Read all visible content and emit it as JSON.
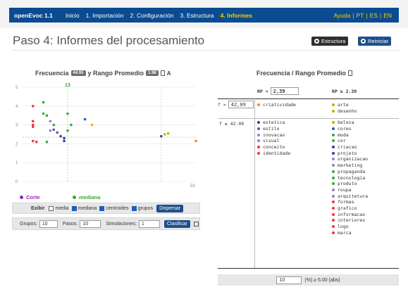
{
  "nav": {
    "brand": "openEvoc 1.1",
    "items": [
      "Inicio",
      "1. Importación",
      "2. Configuración",
      "3. Estructura",
      "4. Informes"
    ],
    "help": "Ayuda",
    "langs": [
      "PT",
      "ES",
      "EN"
    ]
  },
  "page": {
    "title": "Paso 4: Informes del procesamiento",
    "estructura_button": "Estructura",
    "reiniciar_button": "Reiniciar"
  },
  "left": {
    "title_a": "Frecuencia",
    "badge_a": "44.95",
    "title_b": "y Rango Promedio",
    "badge_b": "1.98",
    "legend_corte": "Corte",
    "legend_mediana": "mediana",
    "colors": {
      "corte": "#a020c0",
      "mediana": "#3aa83a",
      "accent": "#f08a1c"
    },
    "exhibir": {
      "label": "Exibir",
      "options": [
        "media",
        "mediana",
        "centroides",
        "grupos"
      ],
      "checked": [
        false,
        true,
        true,
        true
      ],
      "button": "Dispersar"
    },
    "params": {
      "grupos_label": "Grupos:",
      "grupos": "10",
      "pasos_label": "Pasos:",
      "pasos": "10",
      "sim_label": "Simulaciones:",
      "sim": "1",
      "button": "Clasificar"
    }
  },
  "chart_data": {
    "type": "scatter",
    "xlim": [
      0,
      50
    ],
    "ylim": [
      0,
      5
    ],
    "yticks": [
      "0",
      "1",
      "2",
      "3",
      "4",
      "5"
    ],
    "xticks": [
      "0",
      "50"
    ],
    "mark_x": "13",
    "ref_x": 13,
    "ref_y": 2.35,
    "ref_x2": 40,
    "points": [
      {
        "x": 3,
        "y": 4.0,
        "c": "#e8374a"
      },
      {
        "x": 3,
        "y": 3.2,
        "c": "#e8374a"
      },
      {
        "x": 3,
        "y": 3.0,
        "c": "#e8374a"
      },
      {
        "x": 3,
        "y": 2.9,
        "c": "#e8374a"
      },
      {
        "x": 3,
        "y": 2.15,
        "c": "#e8374a"
      },
      {
        "x": 4,
        "y": 2.1,
        "c": "#e8374a"
      },
      {
        "x": 6,
        "y": 4.2,
        "c": "#3aa83a"
      },
      {
        "x": 6,
        "y": 3.6,
        "c": "#3aa83a"
      },
      {
        "x": 7,
        "y": 3.5,
        "c": "#3aa83a"
      },
      {
        "x": 7,
        "y": 2.1,
        "c": "#3aa83a"
      },
      {
        "x": 8,
        "y": 3.2,
        "c": "#9c7bcf"
      },
      {
        "x": 9,
        "y": 3.0,
        "c": "#3aa83a"
      },
      {
        "x": 8,
        "y": 2.7,
        "c": "#9c7bcf"
      },
      {
        "x": 9,
        "y": 2.75,
        "c": "#6a4fb2"
      },
      {
        "x": 10,
        "y": 2.6,
        "c": "#6a4fb2"
      },
      {
        "x": 11,
        "y": 2.4,
        "c": "#3a3a9c"
      },
      {
        "x": 12,
        "y": 2.3,
        "c": "#3a3a9c"
      },
      {
        "x": 12,
        "y": 2.15,
        "c": "#3a3a9c"
      },
      {
        "x": 13,
        "y": 3.6,
        "c": "#3aa83a"
      },
      {
        "x": 14,
        "y": 3.0,
        "c": "#3aa83a"
      },
      {
        "x": 13,
        "y": 2.7,
        "c": "#3aa83a"
      },
      {
        "x": 20,
        "y": 3.0,
        "c": "#f5b400"
      },
      {
        "x": 18,
        "y": 3.3,
        "c": "#1d5fb8"
      },
      {
        "x": 40,
        "y": 2.4,
        "c": "#3a3a9c"
      },
      {
        "x": 41,
        "y": 2.5,
        "c": "#b8b800"
      },
      {
        "x": 42,
        "y": 2.55,
        "c": "#b8b800"
      },
      {
        "x": 50,
        "y": 2.15,
        "c": "#f08a1c"
      }
    ]
  },
  "right": {
    "title": "Frecuencia / Rango Promedio",
    "col1_label": "RP <",
    "col1_value": "2,39",
    "col2_label": "RP ≥ 2.39",
    "row1_label": "f >",
    "row1_value": "42,09",
    "row2_label": "f ≤ 42.09",
    "q1": [
      {
        "t": "criatividade",
        "c": "#f08a1c"
      }
    ],
    "q2": [
      {
        "t": "arte",
        "c": "#c0b000"
      },
      {
        "t": "desenho",
        "c": "#c0b000"
      }
    ],
    "q3": [
      {
        "t": "estetica",
        "c": "#3a3a9c"
      },
      {
        "t": "estilo",
        "c": "#6a4fb2"
      },
      {
        "t": "inovacao",
        "c": "#9c7bcf"
      },
      {
        "t": "visual",
        "c": "#9c7bcf"
      },
      {
        "t": "conceito",
        "c": "#e8374a"
      },
      {
        "t": "identidade",
        "c": "#e8374a"
      }
    ],
    "q4": [
      {
        "t": "beleza",
        "c": "#c0b000"
      },
      {
        "t": "cores",
        "c": "#1d5fb8"
      },
      {
        "t": "moda",
        "c": "#3aa83a"
      },
      {
        "t": "cor",
        "c": "#3aa83a"
      },
      {
        "t": "criacao",
        "c": "#3a3a9c"
      },
      {
        "t": "projeto",
        "c": "#3a3a9c"
      },
      {
        "t": "organizacao",
        "c": "#9c7bcf"
      },
      {
        "t": "marketing",
        "c": "#9c7bcf"
      },
      {
        "t": "propaganda",
        "c": "#3aa83a"
      },
      {
        "t": "tecnologia",
        "c": "#3aa83a"
      },
      {
        "t": "produto",
        "c": "#3aa83a"
      },
      {
        "t": "roupa",
        "c": "#9c7bcf"
      },
      {
        "t": "arquitetura",
        "c": "#9c7bcf"
      },
      {
        "t": "formas",
        "c": "#e8374a"
      },
      {
        "t": "grafico",
        "c": "#e8374a"
      },
      {
        "t": "informacao",
        "c": "#e8374a"
      },
      {
        "t": "interiores",
        "c": "#e8374a"
      },
      {
        "t": "logo",
        "c": "#e8374a"
      },
      {
        "t": "marca",
        "c": "#e8374a"
      }
    ],
    "footer_value": "10",
    "footer_text": "(%) ≥ 5.00 (abs)"
  }
}
